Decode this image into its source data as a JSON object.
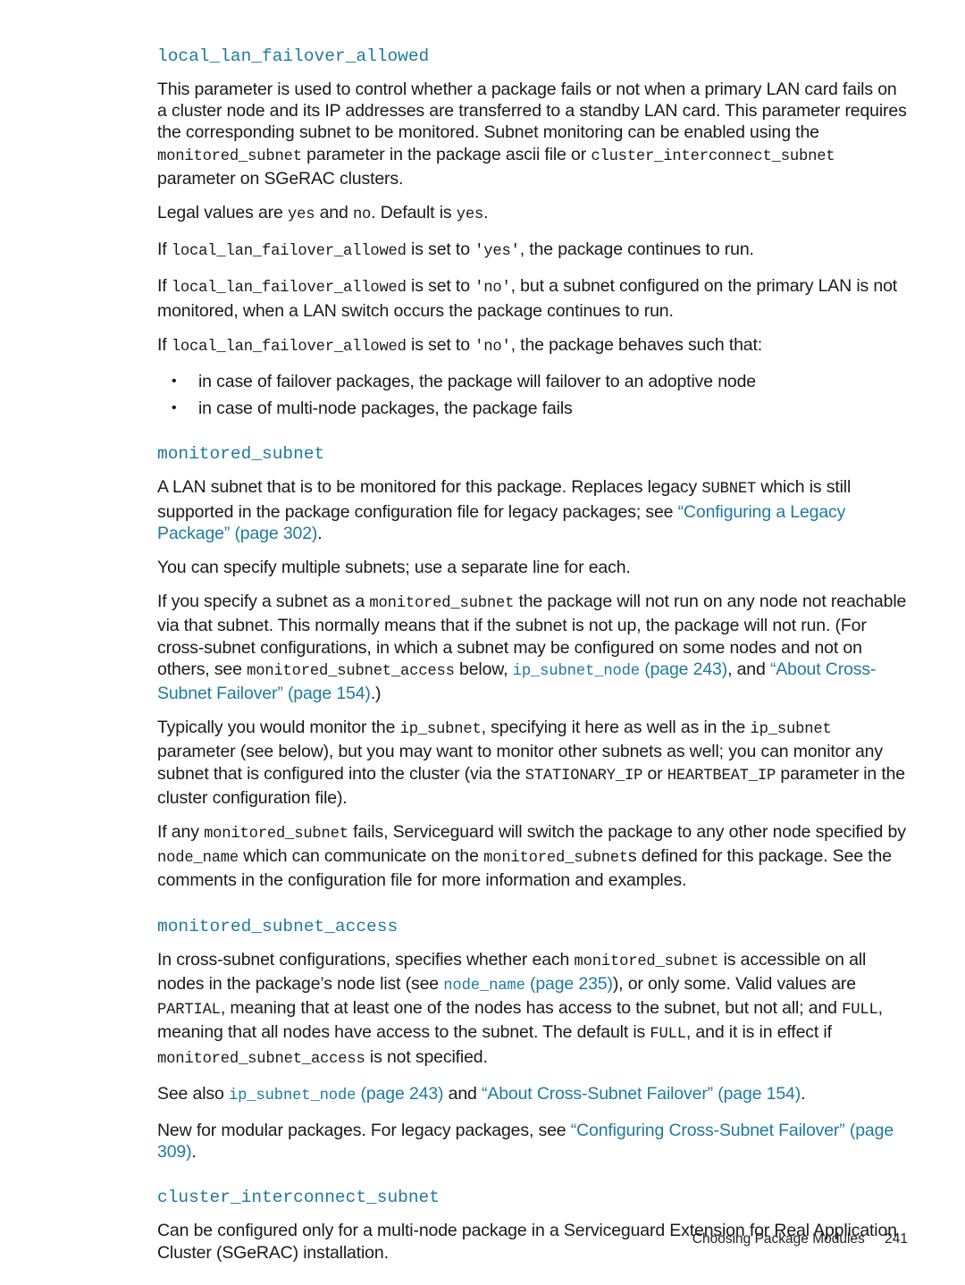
{
  "page": {
    "footer_title": "Choosing Package Modules",
    "footer_page": "241"
  },
  "sections": [
    {
      "heading": "local_lan_failover_allowed",
      "paragraphs": [
        {
          "id": "p1",
          "runs": [
            {
              "t": "This parameter is used to control whether a package fails or not when a primary LAN card fails on a cluster node and its IP addresses are transferred to a standby LAN card. This parameter requires the corresponding subnet to be monitored. Subnet monitoring can be enabled using the ",
              "s": "normal"
            },
            {
              "t": "monitored_subnet",
              "s": "mono"
            },
            {
              "t": " parameter in the package ascii file or ",
              "s": "normal"
            },
            {
              "t": "cluster_interconnect_subnet",
              "s": "mono"
            },
            {
              "t": " parameter on SGeRAC clusters.",
              "s": "normal"
            }
          ]
        },
        {
          "id": "p2",
          "runs": [
            {
              "t": "Legal values are ",
              "s": "normal"
            },
            {
              "t": "yes",
              "s": "mono"
            },
            {
              "t": " and ",
              "s": "normal"
            },
            {
              "t": "no",
              "s": "mono"
            },
            {
              "t": ". Default is ",
              "s": "normal"
            },
            {
              "t": "yes",
              "s": "mono"
            },
            {
              "t": ".",
              "s": "normal"
            }
          ]
        },
        {
          "id": "p3",
          "runs": [
            {
              "t": "If ",
              "s": "normal"
            },
            {
              "t": "local_lan_failover_allowed",
              "s": "mono"
            },
            {
              "t": " is set to ",
              "s": "normal"
            },
            {
              "t": "'yes'",
              "s": "mono"
            },
            {
              "t": ", the package continues to run.",
              "s": "normal"
            }
          ]
        },
        {
          "id": "p4",
          "runs": [
            {
              "t": "If ",
              "s": "normal"
            },
            {
              "t": "local_lan_failover_allowed",
              "s": "mono"
            },
            {
              "t": " is set to ",
              "s": "normal"
            },
            {
              "t": "'no'",
              "s": "mono"
            },
            {
              "t": ", but a subnet configured on the primary LAN is not monitored, when a LAN switch occurs the package continues to run.",
              "s": "normal"
            }
          ]
        },
        {
          "id": "p5",
          "runs": [
            {
              "t": "If ",
              "s": "normal"
            },
            {
              "t": "local_lan_failover_allowed",
              "s": "mono"
            },
            {
              "t": " is set to ",
              "s": "normal"
            },
            {
              "t": "'no'",
              "s": "mono"
            },
            {
              "t": ", the package behaves such that:",
              "s": "normal"
            }
          ]
        }
      ],
      "bullets": [
        "in case of failover packages, the package will failover to an adoptive node",
        "in case of multi-node packages, the package fails"
      ]
    },
    {
      "heading": "monitored_subnet",
      "paragraphs": [
        {
          "id": "m1",
          "runs": [
            {
              "t": "A LAN subnet that is to be monitored for this package. Replaces legacy ",
              "s": "normal"
            },
            {
              "t": "SUBNET",
              "s": "mono"
            },
            {
              "t": " which is still supported in the package configuration file for legacy packages; see ",
              "s": "normal"
            },
            {
              "t": "“Configuring a Legacy Package” (page 302)",
              "s": "xref"
            },
            {
              "t": ".",
              "s": "normal"
            }
          ]
        },
        {
          "id": "m2",
          "runs": [
            {
              "t": "You can specify multiple subnets; use a separate line for each.",
              "s": "normal"
            }
          ]
        },
        {
          "id": "m3",
          "runs": [
            {
              "t": "If you specify a subnet as a ",
              "s": "normal"
            },
            {
              "t": "monitored_subnet",
              "s": "mono"
            },
            {
              "t": " the package will not run on any node not reachable via that subnet. This normally means that if the subnet is not up, the package will not run. (For cross-subnet configurations, in which a subnet may be configured on some nodes and not on others, see ",
              "s": "normal"
            },
            {
              "t": "monitored_subnet_access",
              "s": "mono"
            },
            {
              "t": " below, ",
              "s": "normal"
            },
            {
              "t": "ip_subnet_node",
              "s": "xref-mono"
            },
            {
              "t": " (page 243)",
              "s": "xref"
            },
            {
              "t": ", and ",
              "s": "normal"
            },
            {
              "t": "“About Cross-Subnet Failover” (page 154)",
              "s": "xref"
            },
            {
              "t": ".)",
              "s": "normal"
            }
          ]
        },
        {
          "id": "m4",
          "runs": [
            {
              "t": "Typically you would monitor the ",
              "s": "normal"
            },
            {
              "t": "ip_subnet",
              "s": "mono"
            },
            {
              "t": ", specifying it here as well as in the ",
              "s": "normal"
            },
            {
              "t": "ip_subnet",
              "s": "mono"
            },
            {
              "t": " parameter (see below), but you may want to monitor other subnets as well; you can monitor any subnet that is configured into the cluster (via the ",
              "s": "normal"
            },
            {
              "t": "STATIONARY_IP",
              "s": "mono"
            },
            {
              "t": " or ",
              "s": "normal"
            },
            {
              "t": "HEARTBEAT_IP",
              "s": "mono"
            },
            {
              "t": " parameter in the cluster configuration file).",
              "s": "normal"
            }
          ]
        },
        {
          "id": "m5",
          "runs": [
            {
              "t": "If any ",
              "s": "normal"
            },
            {
              "t": "monitored_subnet",
              "s": "mono"
            },
            {
              "t": " fails, Serviceguard will switch the package to any other node specified by ",
              "s": "normal"
            },
            {
              "t": "node_name",
              "s": "mono"
            },
            {
              "t": " which can communicate on the ",
              "s": "normal"
            },
            {
              "t": "monitored_subnet",
              "s": "mono"
            },
            {
              "t": "s defined for this package. See the comments in the configuration file for more information and examples.",
              "s": "normal"
            }
          ]
        }
      ],
      "bullets": []
    },
    {
      "heading": "monitored_subnet_access",
      "paragraphs": [
        {
          "id": "a1",
          "runs": [
            {
              "t": "In cross-subnet configurations, specifies whether each ",
              "s": "normal"
            },
            {
              "t": "monitored_subnet",
              "s": "mono"
            },
            {
              "t": " is accessible on all nodes in the package’s node list (see ",
              "s": "normal"
            },
            {
              "t": "node_name",
              "s": "xref-mono"
            },
            {
              "t": " (page 235)",
              "s": "xref"
            },
            {
              "t": "), or only some. Valid values are ",
              "s": "normal"
            },
            {
              "t": "PARTIAL",
              "s": "mono"
            },
            {
              "t": ", meaning that at least one of the nodes has access to the subnet, but not all; and ",
              "s": "normal"
            },
            {
              "t": "FULL",
              "s": "mono"
            },
            {
              "t": ", meaning that all nodes have access to the subnet. The default is ",
              "s": "normal"
            },
            {
              "t": "FULL",
              "s": "mono"
            },
            {
              "t": ", and it is in effect if ",
              "s": "normal"
            },
            {
              "t": "monitored_subnet_access",
              "s": "mono"
            },
            {
              "t": " is not specified.",
              "s": "normal"
            }
          ]
        },
        {
          "id": "a2",
          "runs": [
            {
              "t": "See also ",
              "s": "normal"
            },
            {
              "t": "ip_subnet_node",
              "s": "xref-mono"
            },
            {
              "t": " (page 243)",
              "s": "xref"
            },
            {
              "t": " and ",
              "s": "normal"
            },
            {
              "t": "“About Cross-Subnet Failover” (page 154)",
              "s": "xref"
            },
            {
              "t": ".",
              "s": "normal"
            }
          ]
        },
        {
          "id": "a3",
          "runs": [
            {
              "t": "New for modular packages. For legacy packages, see ",
              "s": "normal"
            },
            {
              "t": "“Configuring Cross-Subnet Failover” (page 309)",
              "s": "xref"
            },
            {
              "t": ".",
              "s": "normal"
            }
          ]
        }
      ],
      "bullets": []
    },
    {
      "heading": "cluster_interconnect_subnet",
      "paragraphs": [
        {
          "id": "c1",
          "runs": [
            {
              "t": "Can be configured only for a multi-node package in a Serviceguard Extension for Real Application Cluster (SGeRAC) installation.",
              "s": "normal"
            }
          ]
        }
      ],
      "bullets": []
    }
  ]
}
